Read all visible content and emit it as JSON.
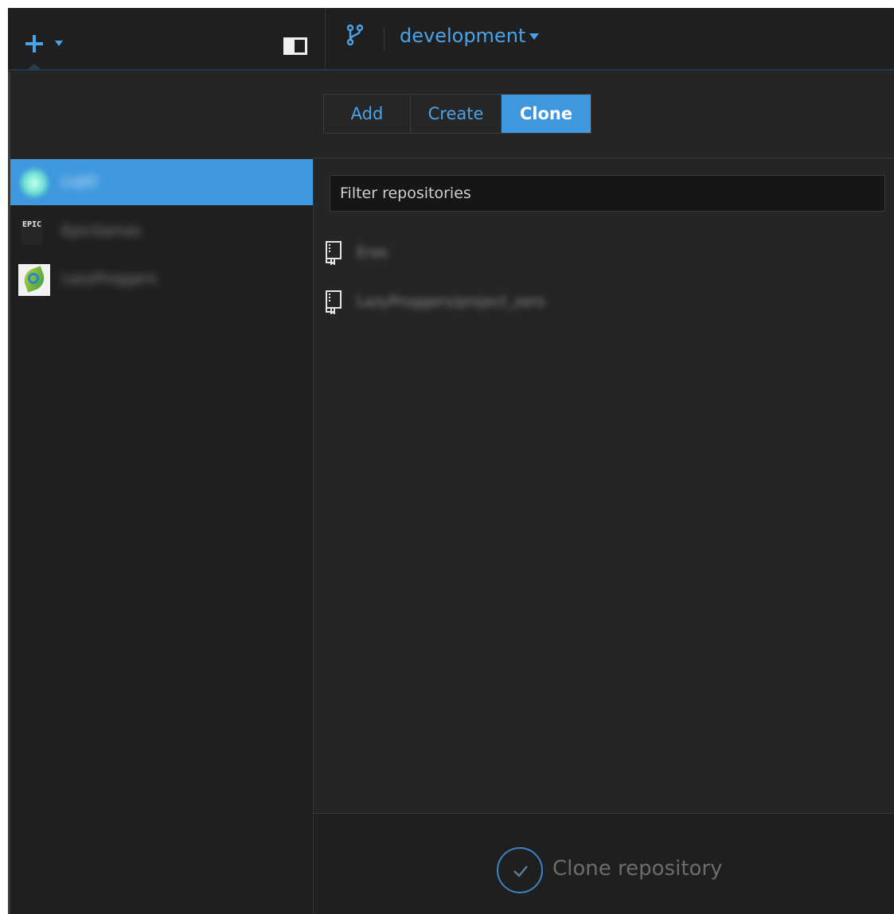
{
  "toolbar": {
    "add_icon": "plus-icon",
    "toggle_icon": "sidebar-toggle-icon",
    "branch_icon": "git-branch-icon",
    "branch": "development",
    "branch_color": "#4aa3e8"
  },
  "tabs": [
    {
      "label": "Add",
      "active": false
    },
    {
      "label": "Create",
      "active": false
    },
    {
      "label": "Clone",
      "active": true
    }
  ],
  "accounts": [
    {
      "name": "LiqID",
      "active": true,
      "avatar": "glow-avatar"
    },
    {
      "name": "EpicGames",
      "active": false,
      "avatar": "epic-games-logo",
      "avatar_text": "EPIC"
    },
    {
      "name": "LazyProggers",
      "active": false,
      "avatar": "lazyproggers-logo"
    }
  ],
  "filter": {
    "placeholder": "Filter repositories",
    "value": ""
  },
  "repositories": [
    {
      "name": "Eras",
      "icon": "repo-icon"
    },
    {
      "name": "LazyProggers/project_zero",
      "icon": "repo-icon"
    }
  ],
  "footer": {
    "clone_label": "Clone repository",
    "icon": "check-circle-icon"
  },
  "colors": {
    "accent": "#3f98de",
    "background": "#252525",
    "sidebar": "#1f1f1f"
  }
}
